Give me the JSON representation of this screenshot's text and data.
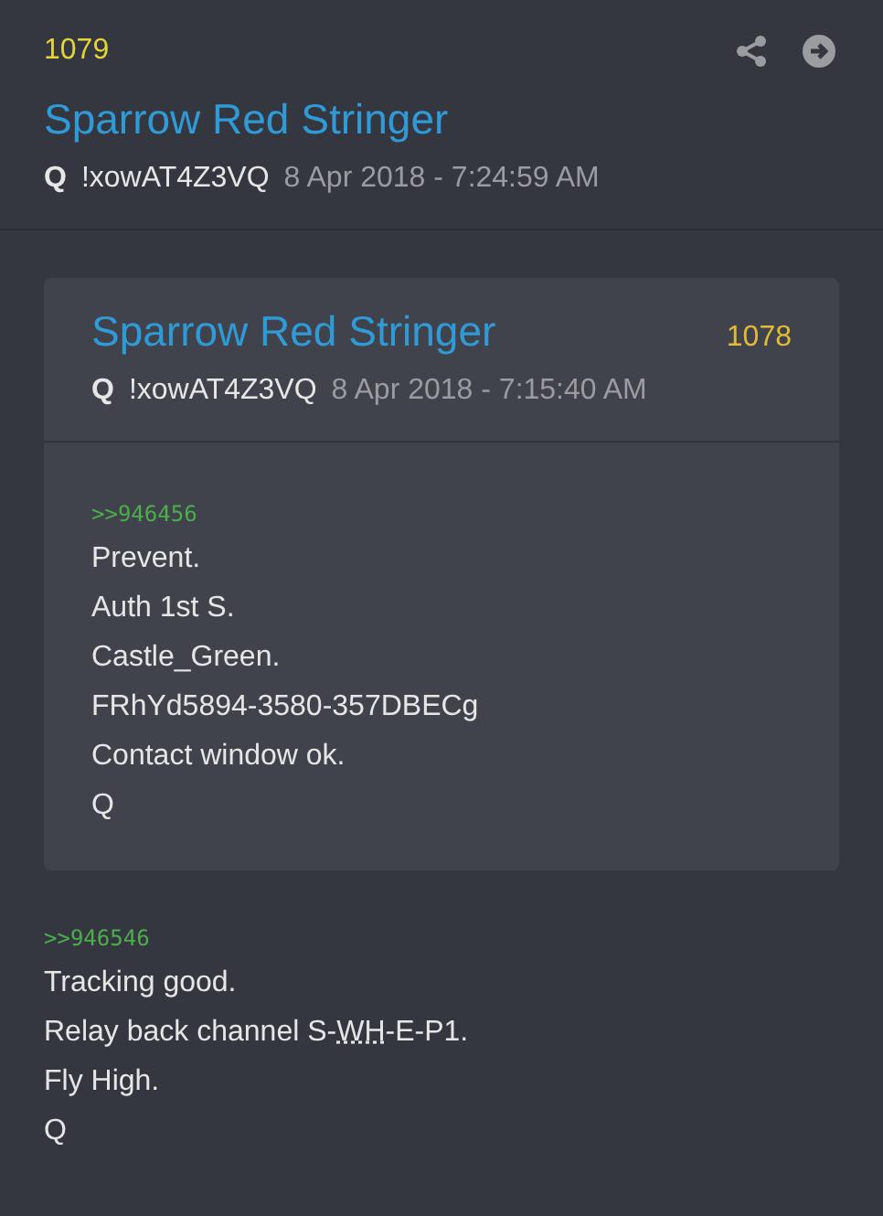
{
  "post": {
    "number": "1079",
    "title": "Sparrow Red Stringer",
    "author": "Q",
    "tripcode": "!xowAT4Z3VQ",
    "timestamp": "8 Apr 2018 - 7:24:59 AM"
  },
  "quoted_post": {
    "title": "Sparrow Red Stringer",
    "number": "1078",
    "author": "Q",
    "tripcode": "!xowAT4Z3VQ",
    "timestamp": "8 Apr 2018 - 7:15:40 AM",
    "reference": ">>946456",
    "lines": [
      {
        "text": "Prevent."
      },
      {
        "text": "Auth 1st S."
      },
      {
        "text": "Castle_Green."
      },
      {
        "text": "FRhYd5894-3580-357DBECg"
      },
      {
        "text": "Contact window ok."
      },
      {
        "text": "Q"
      }
    ]
  },
  "body": {
    "reference": ">>946546",
    "lines": [
      {
        "text": "Tracking good."
      },
      {
        "text": "Relay back channel S-",
        "abbr": "WH",
        "after": "-E-P1."
      },
      {
        "text": "Fly High."
      },
      {
        "text": "Q"
      }
    ]
  }
}
